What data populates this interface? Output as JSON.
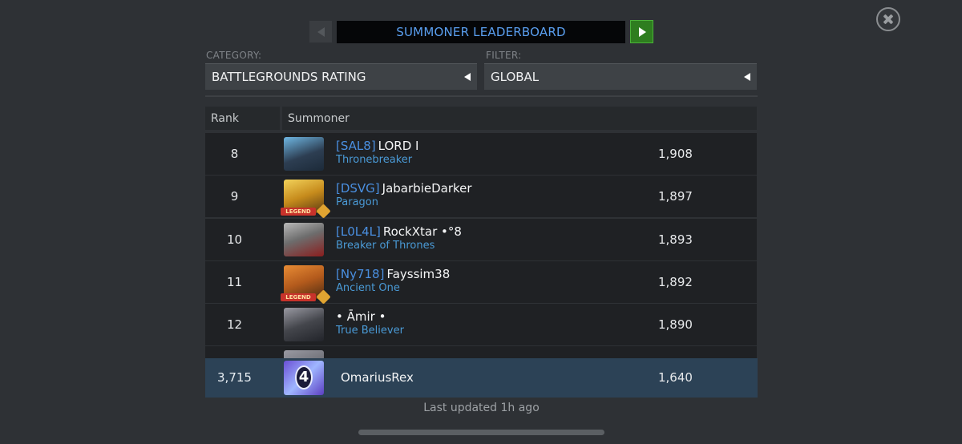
{
  "header": {
    "title": "SUMMONER LEADERBOARD",
    "prev_icon": "triangle-left-icon",
    "next_icon": "play-triangle-icon",
    "close_icon": "close-x-icon"
  },
  "category": {
    "caption": "CATEGORY:",
    "value": "BATTLEGROUNDS RATING"
  },
  "filter": {
    "caption": "FILTER:",
    "value": "GLOBAL"
  },
  "table": {
    "columns": {
      "rank": "Rank",
      "summoner": "Summoner"
    },
    "rows": [
      {
        "rank": "8",
        "tag": "[SAL8]",
        "name": "LORD I",
        "title": "Thronebreaker",
        "score": "1,908",
        "legend": false
      },
      {
        "rank": "9",
        "tag": "[DSVG]",
        "name": "JabarbieDarker",
        "title": "Paragon",
        "score": "1,897",
        "legend": true
      },
      {
        "rank": "10",
        "tag": "[L0L4L]",
        "name": "RockXtar •°8",
        "title": "Breaker of Thrones",
        "score": "1,893",
        "legend": false
      },
      {
        "rank": "11",
        "tag": "[Ny718]",
        "name": "Fayssim38",
        "title": "Ancient One",
        "score": "1,892",
        "legend": true
      },
      {
        "rank": "12",
        "tag": "",
        "name": "• Āmir •",
        "title": "True Believer",
        "score": "1,890",
        "legend": false
      }
    ],
    "legend_label": "LEGEND"
  },
  "user": {
    "rank": "3,715",
    "name": "OmariusRex",
    "score": "1,640"
  },
  "footer": {
    "updated": "Last updated 1h ago"
  },
  "colors": {
    "background": "#2e3135",
    "title_text": "#5a9ff0",
    "next_button": "#2e7d1f",
    "alliance_tag": "#4a8fe0",
    "user_row": "#2c4256"
  }
}
